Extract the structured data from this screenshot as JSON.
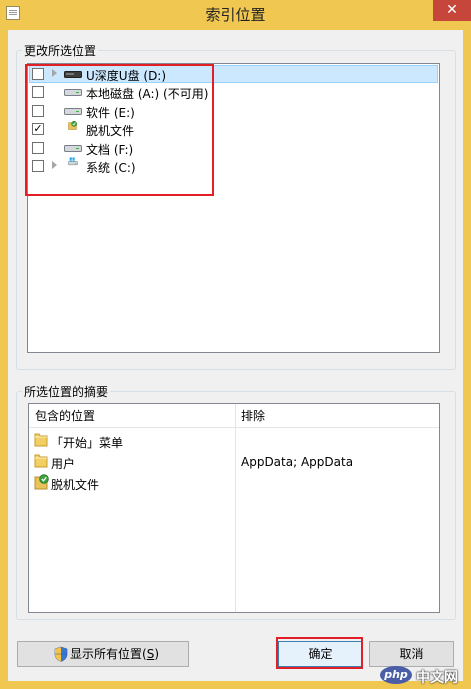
{
  "window": {
    "title": "索引位置",
    "close_glyph": "✕"
  },
  "change_group": {
    "label": "更改所选位置",
    "items": [
      {
        "label": "U深度U盘 (D:)",
        "checked": false,
        "expandable": true,
        "selected": true,
        "icon": "usb-drive-icon"
      },
      {
        "label": "本地磁盘 (A:) (不可用)",
        "checked": false,
        "expandable": false,
        "selected": false,
        "icon": "local-disk-icon"
      },
      {
        "label": "软件 (E:)",
        "checked": false,
        "expandable": false,
        "selected": false,
        "icon": "local-disk-icon"
      },
      {
        "label": "脱机文件",
        "checked": true,
        "expandable": false,
        "selected": false,
        "icon": "offline-files-icon"
      },
      {
        "label": "文档 (F:)",
        "checked": false,
        "expandable": false,
        "selected": false,
        "icon": "local-disk-icon"
      },
      {
        "label": "系统 (C:)",
        "checked": false,
        "expandable": true,
        "selected": false,
        "icon": "system-disk-icon"
      }
    ]
  },
  "summary_group": {
    "label": "所选位置的摘要",
    "columns": [
      "包含的位置",
      "排除"
    ],
    "rows": [
      {
        "location": "「开始」菜单",
        "exclude": "",
        "icon": "folder-icon"
      },
      {
        "location": "用户",
        "exclude": "AppData; AppData",
        "icon": "folder-icon"
      },
      {
        "location": "脱机文件",
        "exclude": "",
        "icon": "offline-files-icon"
      }
    ]
  },
  "buttons": {
    "show_all": "显示所有位置(S)",
    "show_all_text": "显示所有位置(",
    "show_all_key": "S",
    "show_all_close": ")",
    "ok": "确定",
    "cancel": "取消"
  },
  "watermark": {
    "text": "中文网",
    "logo": "php"
  },
  "colors": {
    "titlebar": "#f0c750",
    "close": "#c7463c",
    "highlight": "#e21f26",
    "selection": "#cce8ff"
  }
}
